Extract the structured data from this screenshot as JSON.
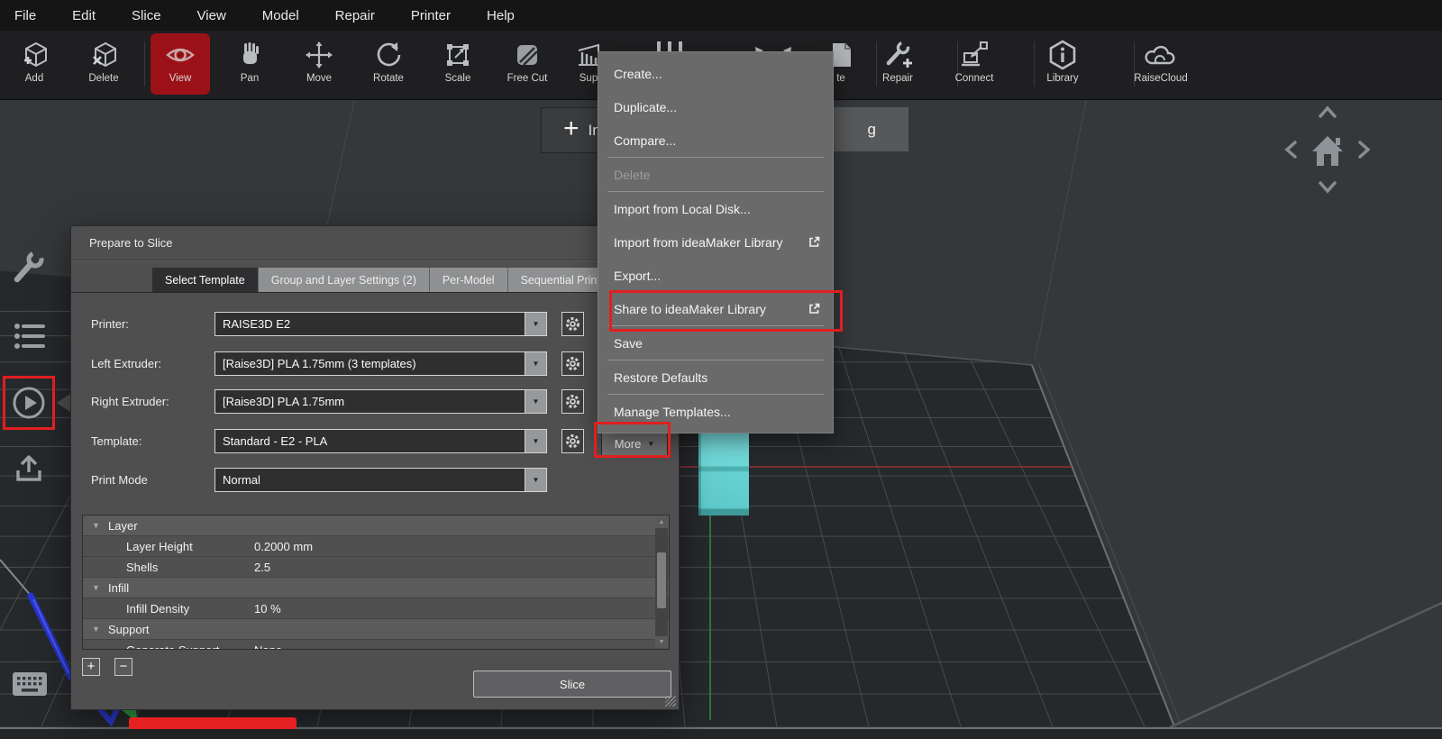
{
  "menubar": {
    "items": [
      "File",
      "Edit",
      "Slice",
      "View",
      "Model",
      "Repair",
      "Printer",
      "Help"
    ]
  },
  "toolbar": {
    "items": [
      {
        "label": "Add"
      },
      {
        "label": "Delete"
      },
      {
        "label": "View",
        "active": true
      },
      {
        "label": "Pan"
      },
      {
        "label": "Move"
      },
      {
        "label": "Rotate"
      },
      {
        "label": "Scale"
      },
      {
        "label": "Free Cut"
      },
      {
        "label": "Sup"
      },
      {
        "label": "te"
      },
      {
        "label": "Repair"
      },
      {
        "label": "Connect"
      },
      {
        "label": "Library"
      },
      {
        "label": "RaiseCloud"
      }
    ]
  },
  "viewport": {
    "import_button_fragment": "In",
    "secondary_button_fragment": "g"
  },
  "context_menu": {
    "items": [
      {
        "label": "Create..."
      },
      {
        "label": "Duplicate..."
      },
      {
        "label": "Compare..."
      },
      {
        "label": "Delete",
        "disabled": true
      },
      {
        "label": "Import from Local Disk..."
      },
      {
        "label": "Import from ideaMaker Library",
        "external": true
      },
      {
        "label": "Export..."
      },
      {
        "label": "Share to ideaMaker Library",
        "external": true,
        "highlighted": true
      },
      {
        "label": "Save"
      },
      {
        "label": "Restore Defaults"
      },
      {
        "label": "Manage Templates..."
      }
    ]
  },
  "dialog": {
    "title": "Prepare to Slice",
    "tabs": [
      {
        "label": "Select Template",
        "active": true
      },
      {
        "label": "Group and Layer Settings (2)"
      },
      {
        "label": "Per-Model"
      },
      {
        "label": "Sequential Printi"
      }
    ],
    "fields": [
      {
        "label": "Printer:",
        "value": "RAISE3D E2"
      },
      {
        "label": "Left Extruder:",
        "value": "[Raise3D] PLA 1.75mm (3 templates)"
      },
      {
        "label": "Right Extruder:",
        "value": "[Raise3D] PLA 1.75mm"
      },
      {
        "label": "Template:",
        "value": "Standard - E2 - PLA"
      },
      {
        "label": "Print Mode",
        "value": "Normal"
      }
    ],
    "more_button": "More",
    "settings": [
      {
        "type": "group",
        "label": "Layer"
      },
      {
        "type": "item",
        "label": "Layer Height",
        "value": "0.2000 mm"
      },
      {
        "type": "item",
        "label": "Shells",
        "value": "2.5"
      },
      {
        "type": "group",
        "label": "Infill"
      },
      {
        "type": "item",
        "label": "Infill Density",
        "value": "10 %"
      },
      {
        "type": "group",
        "label": "Support"
      },
      {
        "type": "item",
        "label": "Generate Support",
        "value": "None"
      }
    ],
    "add_button": "+",
    "remove_button": "−",
    "slice_button": "Slice"
  },
  "colors": {
    "annotation_red": "#e01f1f",
    "active_tool_red": "#9c1117",
    "model_teal": "#66d0d0",
    "x_axis_red": "#77302f",
    "y_axis_green": "#2f9e3f",
    "z_axis_blue": "#2734d6"
  }
}
